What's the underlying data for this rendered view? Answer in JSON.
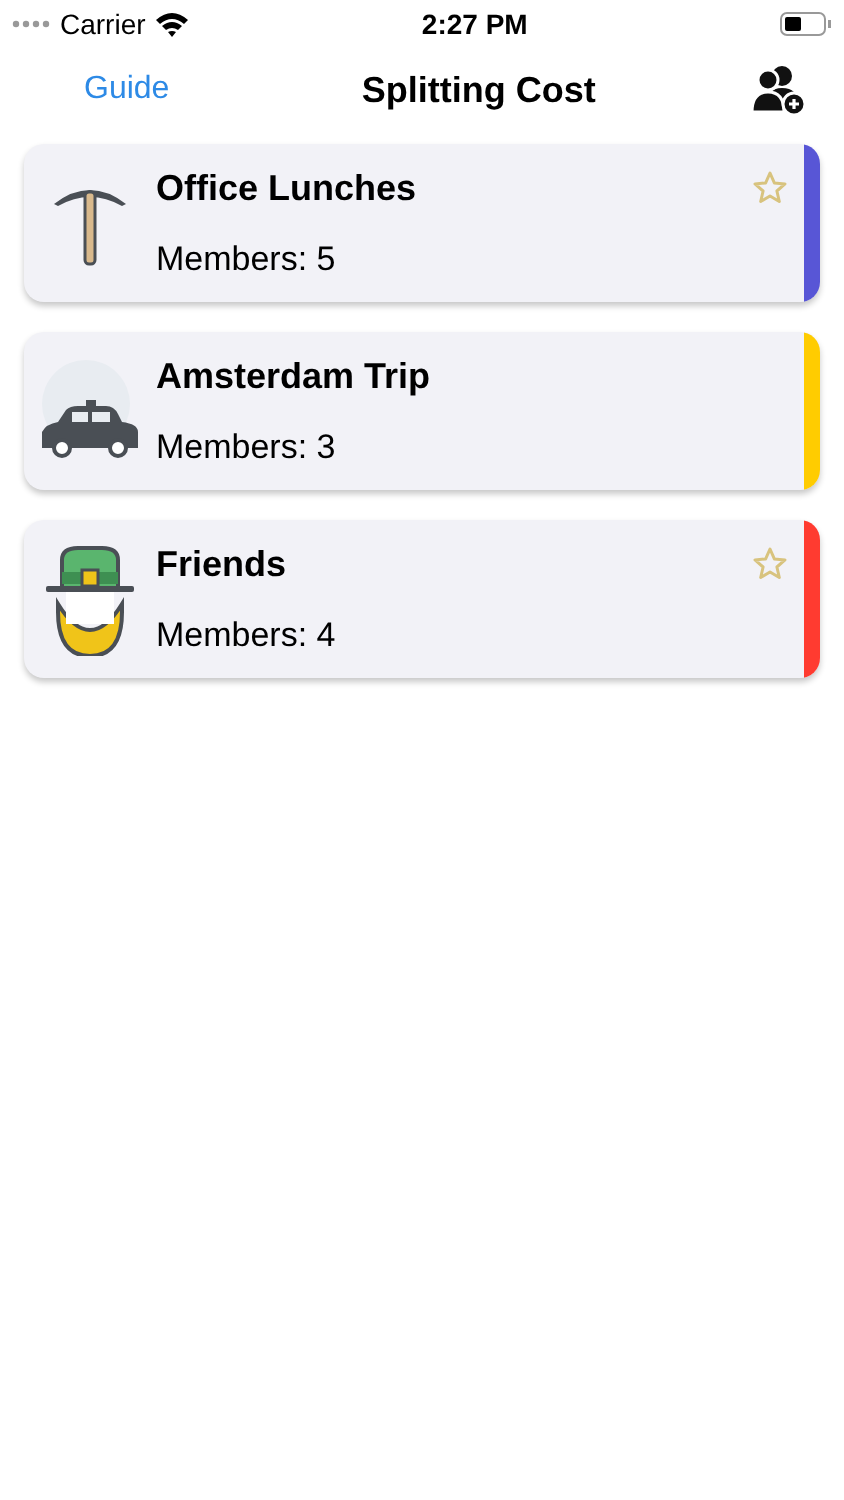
{
  "status_bar": {
    "carrier": "Carrier",
    "time": "2:27 PM"
  },
  "nav": {
    "left": "Guide",
    "title": "Splitting Cost"
  },
  "groups": [
    {
      "name": "Office Lunches",
      "members": "Members: 5",
      "kind": "pickaxe",
      "color": "#5856d6",
      "starred": true
    },
    {
      "name": "Amsterdam Trip",
      "members": "Members: 3",
      "kind": "taxi",
      "color": "#ffcc00",
      "starred": false
    },
    {
      "name": "Friends",
      "members": "Members: 4",
      "kind": "hat",
      "color": "#ff3b30",
      "starred": true
    }
  ]
}
